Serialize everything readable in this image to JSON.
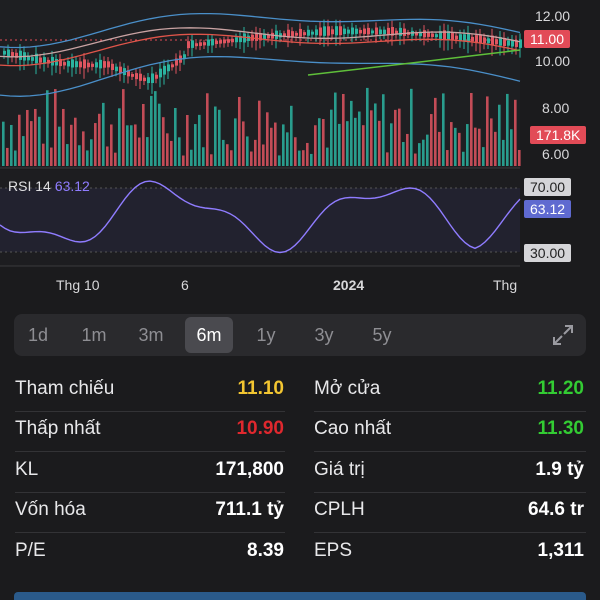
{
  "chart": {
    "y_labels": [
      "12.00",
      "10.00",
      "8.00",
      "6.00"
    ],
    "price_tag": "11.00",
    "volume_tag": "171.8K",
    "rsi": {
      "label": "RSI 14",
      "value": "63.12",
      "levels": [
        "70.00",
        "30.00"
      ],
      "tag": "63.12"
    },
    "x_labels": [
      "Thg 10",
      "6",
      "2024",
      "Thg"
    ],
    "colors": {
      "up": "#2bb3a0",
      "down": "#e05560",
      "rsi_line": "#8f7cff",
      "price_tag_bg": "#e24b57",
      "band": "#4a8fc9",
      "ma_red": "#e0554a",
      "ma_green": "#5fbf3a"
    }
  },
  "range": {
    "options": [
      "1d",
      "1m",
      "3m",
      "6m",
      "1y",
      "3y",
      "5y"
    ],
    "active": "6m"
  },
  "stats": [
    {
      "label": "Tham chiếu",
      "value": "11.10",
      "color": "#f2c531"
    },
    {
      "label": "Mở cửa",
      "value": "11.20",
      "color": "#33cc33"
    },
    {
      "label": "Thấp nhất",
      "value": "10.90",
      "color": "#e0282e"
    },
    {
      "label": "Cao nhất",
      "value": "11.30",
      "color": "#33cc33"
    },
    {
      "label": "KL",
      "value": "171,800",
      "color": "#ffffff"
    },
    {
      "label": "Giá trị",
      "value": "1.9 tỷ",
      "color": "#ffffff"
    },
    {
      "label": "Vốn hóa",
      "value": "711.1 tỷ",
      "color": "#ffffff"
    },
    {
      "label": "CPLH",
      "value": "64.6 tr",
      "color": "#ffffff"
    },
    {
      "label": "P/E",
      "value": "8.39",
      "color": "#ffffff"
    },
    {
      "label": "EPS",
      "value": "1,311",
      "color": "#ffffff"
    }
  ]
}
